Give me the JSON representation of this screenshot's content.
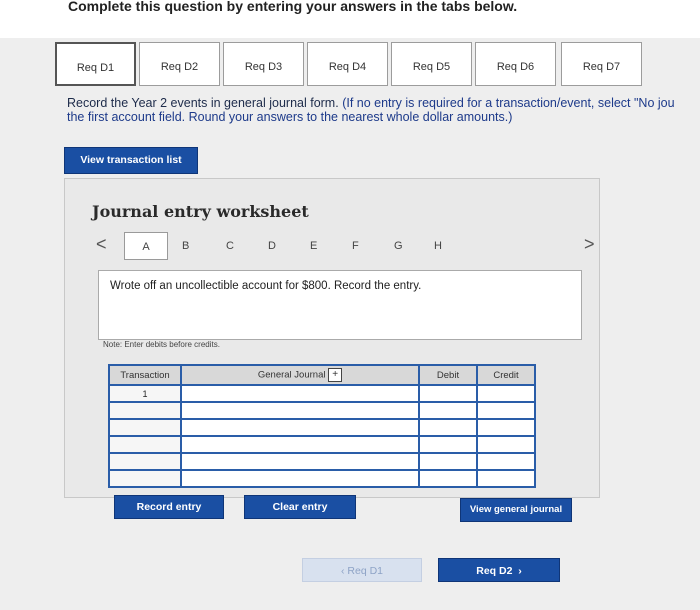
{
  "header": {
    "title": "Complete this question by entering your answers in the tabs below."
  },
  "tabs": [
    {
      "label": "Req D1"
    },
    {
      "label": "Req D2"
    },
    {
      "label": "Req D3"
    },
    {
      "label": "Req D4"
    },
    {
      "label": "Req D5"
    },
    {
      "label": "Req D6"
    },
    {
      "label": "Req D7"
    }
  ],
  "instructions": {
    "line1": "Record the Year 2 events in general journal form.",
    "line1_blue": "(If no entry is required for a transaction/event, select \"No jou",
    "line2": "the first account field. Round your answers to the nearest whole dollar amounts.)"
  },
  "view_transaction_list": "View transaction list",
  "worksheet": {
    "title": "Journal entry worksheet",
    "letters": [
      "A",
      "B",
      "C",
      "D",
      "E",
      "F",
      "G",
      "H"
    ],
    "description": "Wrote off an uncollectible account for $800. Record the entry.",
    "note": "Note: Enter debits before credits.",
    "columns": {
      "transaction": "Transaction",
      "general_journal": "General Journal",
      "debit": "Debit",
      "credit": "Credit"
    },
    "rows": [
      {
        "transaction": "1",
        "account": "",
        "debit": "",
        "credit": ""
      },
      {
        "transaction": "",
        "account": "",
        "debit": "",
        "credit": ""
      },
      {
        "transaction": "",
        "account": "",
        "debit": "",
        "credit": ""
      },
      {
        "transaction": "",
        "account": "",
        "debit": "",
        "credit": ""
      },
      {
        "transaction": "",
        "account": "",
        "debit": "",
        "credit": ""
      },
      {
        "transaction": "",
        "account": "",
        "debit": "",
        "credit": ""
      }
    ],
    "buttons": {
      "record": "Record entry",
      "clear": "Clear entry",
      "view_journal": "View general journal"
    }
  },
  "nav": {
    "prev": "Req D1",
    "next": "Req D2"
  },
  "colors": {
    "accent": "#1a4fa3",
    "table_border": "#2a5da8"
  }
}
